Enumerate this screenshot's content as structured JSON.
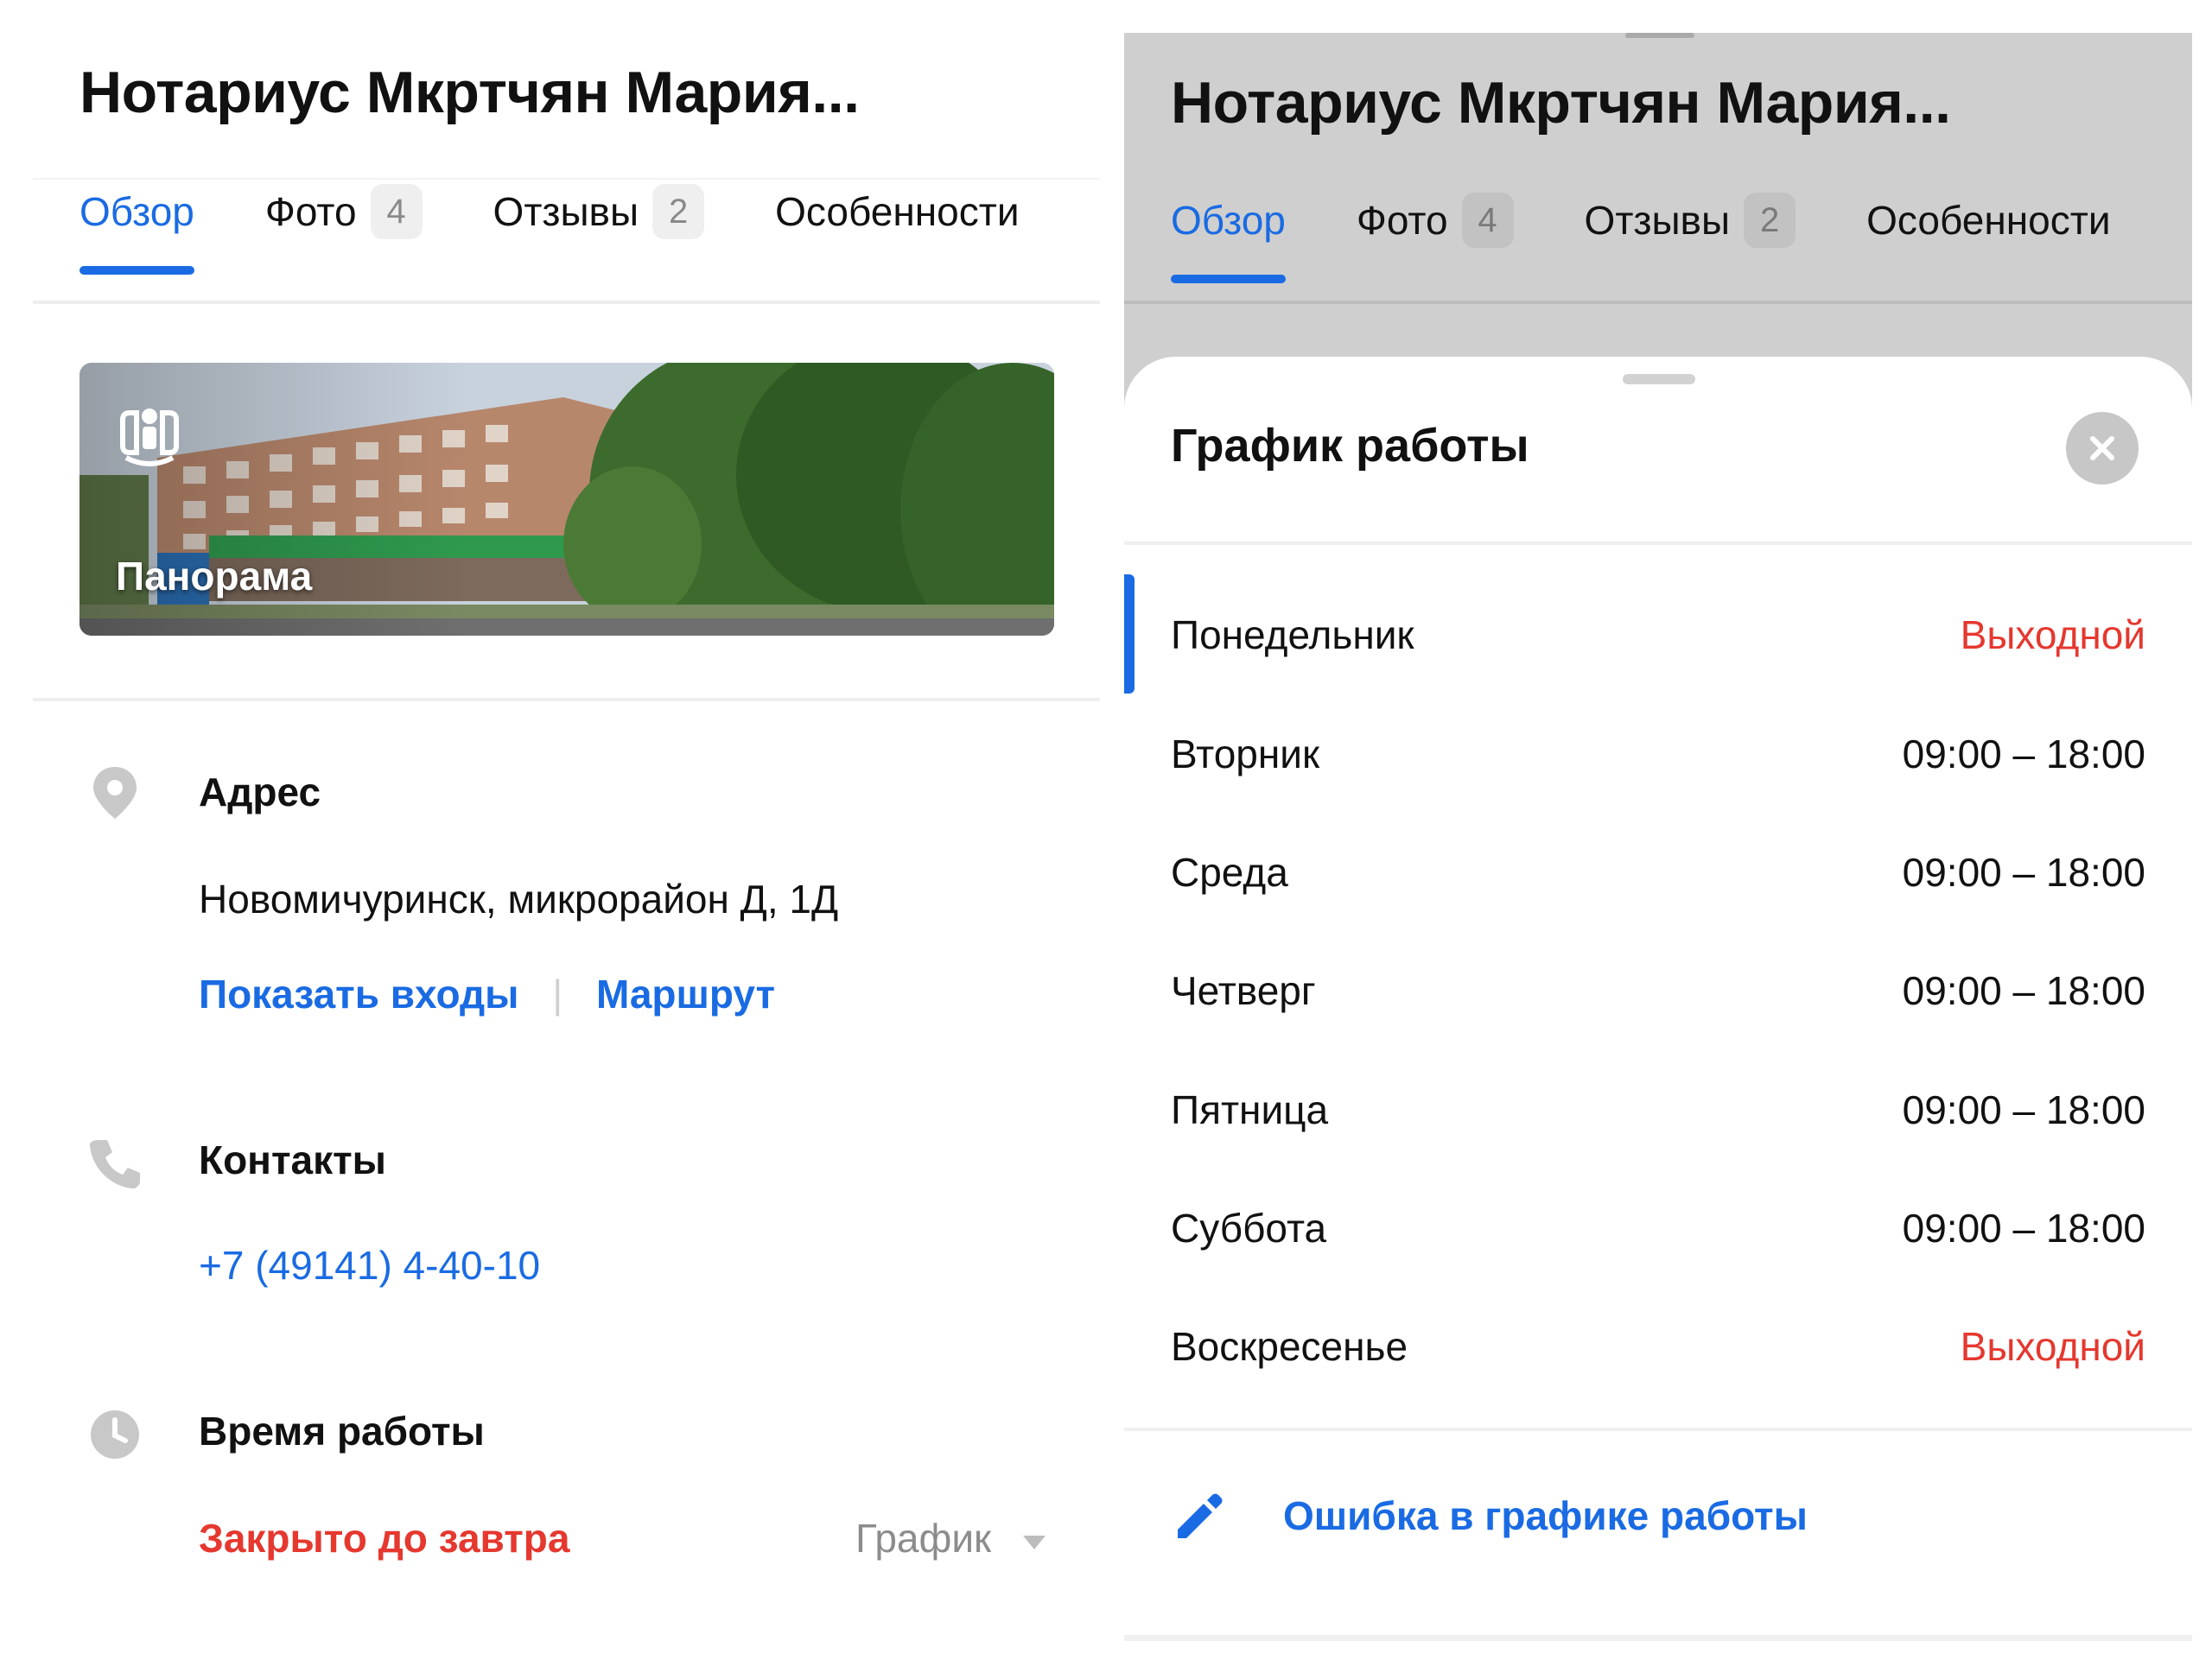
{
  "colors": {
    "accent": "#1a6be3",
    "danger": "#e5382f",
    "muted": "#8c8c8c",
    "dim_overlay": "#cfcfcf"
  },
  "left": {
    "title": "Нотариус Мкртчян Мария...",
    "tabs": [
      {
        "label": "Обзор",
        "active": true
      },
      {
        "label": "Фото",
        "count": "4"
      },
      {
        "label": "Отзывы",
        "count": "2"
      },
      {
        "label": "Особенности"
      }
    ],
    "panorama": {
      "label": "Панорама",
      "icon": "panorama-person-icon"
    },
    "address": {
      "heading": "Адрес",
      "icon": "location-pin-icon",
      "value": "Новомичуринск, микрорайон Д, 1Д",
      "show_entrances": "Показать входы",
      "separator": "|",
      "route": "Маршрут"
    },
    "contacts": {
      "heading": "Контакты",
      "icon": "phone-icon",
      "phone": "+7 (49141) 4-40-10"
    },
    "hours": {
      "heading": "Время работы",
      "icon": "clock-icon",
      "status": "Закрыто до завтра",
      "schedule_label": "График",
      "schedule_icon": "triangle-down-icon"
    }
  },
  "right": {
    "title": "Нотариус Мкртчян Мария...",
    "tabs": [
      {
        "label": "Обзор",
        "active": true
      },
      {
        "label": "Фото",
        "count": "4"
      },
      {
        "label": "Отзывы",
        "count": "2"
      },
      {
        "label": "Особенности"
      }
    ],
    "sheet": {
      "title": "График работы",
      "close_icon": "close-icon",
      "days": [
        {
          "day": "Понедельник",
          "hours": "Выходной",
          "off": true,
          "current": true
        },
        {
          "day": "Вторник",
          "hours": "09:00 – 18:00"
        },
        {
          "day": "Среда",
          "hours": "09:00 – 18:00"
        },
        {
          "day": "Четверг",
          "hours": "09:00 – 18:00"
        },
        {
          "day": "Пятница",
          "hours": "09:00 – 18:00"
        },
        {
          "day": "Суббота",
          "hours": "09:00 – 18:00"
        },
        {
          "day": "Воскресенье",
          "hours": "Выходной",
          "off": true
        }
      ],
      "report_error": "Ошибка в графике работы",
      "report_icon": "pencil-icon"
    }
  }
}
